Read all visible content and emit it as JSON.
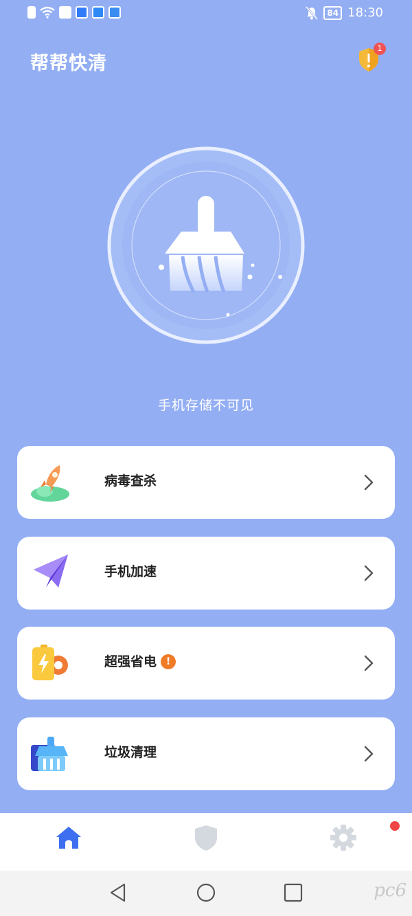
{
  "status_bar": {
    "time": "18:30",
    "battery": "84"
  },
  "header": {
    "title": "帮帮快清",
    "alert_count": "1"
  },
  "hero": {
    "status_text": "手机存储不可见"
  },
  "features": [
    {
      "label": "病毒查杀"
    },
    {
      "label": "手机加速"
    },
    {
      "label": "超强省电",
      "badge": "!"
    },
    {
      "label": "垃圾清理"
    }
  ],
  "watermark": "pc6",
  "colors": {
    "background": "#93aef3",
    "accent": "#3d6ff0",
    "alert": "#f05353",
    "warning": "#f07b27"
  }
}
